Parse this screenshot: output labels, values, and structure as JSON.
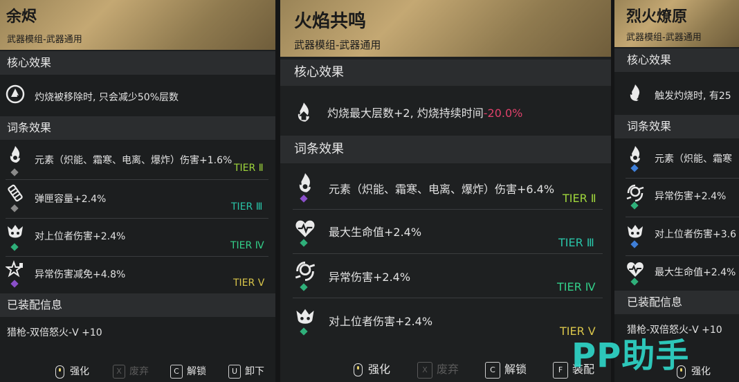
{
  "colors": {
    "tier2": "#9fd63c",
    "tier3": "#29c4a8",
    "tier4": "#33d08a",
    "tier5": "#d9c54a",
    "negative": "#e0416b",
    "gold": "#c4a873"
  },
  "cards": [
    {
      "title": "余烬",
      "subtitle": "武器模组-武器通用",
      "core_header": "核心效果",
      "core_text": "灼烧被移除时, 只会减少50%层数",
      "affix_header": "词条效果",
      "affixes": [
        {
          "text": "元素（炽能、霜寒、电离、爆炸）伤害+1.6%",
          "tier": "TIER Ⅱ",
          "icon": "flame-element-icon",
          "gem": "gray"
        },
        {
          "text": "弹匣容量+2.4%",
          "tier": "TIER Ⅲ",
          "icon": "magazine-icon",
          "gem": "gray"
        },
        {
          "text": "对上位者伤害+2.4%",
          "tier": "TIER Ⅳ",
          "icon": "demon-skull-icon",
          "gem": "green"
        },
        {
          "text": "异常伤害减免+4.8%",
          "tier": "TIER Ⅴ",
          "icon": "star-shield-icon",
          "gem": "purple"
        }
      ],
      "equip_header": "已装配信息",
      "equip_text": "猎枪-双倍怒火-Ⅴ +10",
      "actions": [
        {
          "key": "mouse",
          "label": "强化",
          "disabled": false
        },
        {
          "key": "X",
          "label": "废弃",
          "disabled": true
        },
        {
          "key": "C",
          "label": "解锁",
          "disabled": false
        },
        {
          "key": "U",
          "label": "卸下",
          "disabled": false
        }
      ]
    },
    {
      "title": "火焰共鸣",
      "subtitle": "武器模组-武器通用",
      "core_header": "核心效果",
      "core_text": "灼烧最大层数+2, 灼烧持续时间",
      "core_neg": "-20.0%",
      "affix_header": "词条效果",
      "affixes": [
        {
          "text": "元素（炽能、霜寒、电离、爆炸）伤害+6.4%",
          "tier": "TIER Ⅱ",
          "icon": "flame-element-icon",
          "gem": "purple"
        },
        {
          "text": "最大生命值+2.4%",
          "tier": "TIER Ⅲ",
          "icon": "heart-pulse-icon",
          "gem": "green"
        },
        {
          "text": "异常伤害+2.4%",
          "tier": "TIER Ⅳ",
          "icon": "anomaly-icon",
          "gem": "green"
        },
        {
          "text": "对上位者伤害+2.4%",
          "tier": "TIER Ⅴ",
          "icon": "demon-skull-icon",
          "gem": "green"
        }
      ],
      "actions": [
        {
          "key": "mouse",
          "label": "强化",
          "disabled": false
        },
        {
          "key": "X",
          "label": "废弃",
          "disabled": true
        },
        {
          "key": "C",
          "label": "解锁",
          "disabled": false
        },
        {
          "key": "F",
          "label": "装配",
          "disabled": false
        }
      ]
    },
    {
      "title": "烈火燎原",
      "subtitle": "武器模组-武器通用",
      "core_header": "核心效果",
      "core_text": "触发灼烧时, 有25",
      "affix_header": "词条效果",
      "affixes": [
        {
          "text": "元素（炽能、霜寒",
          "icon": "flame-element-icon",
          "gem": "blue"
        },
        {
          "text": "异常伤害+2.4%",
          "icon": "anomaly-icon",
          "gem": "green"
        },
        {
          "text": "对上位者伤害+3.6",
          "icon": "demon-skull-icon",
          "gem": "blue"
        },
        {
          "text": "最大生命值+2.4%",
          "icon": "heart-pulse-icon",
          "gem": "green"
        }
      ],
      "equip_header": "已装配信息",
      "equip_text": "猎枪-双倍怒火-Ⅴ +10",
      "actions": [
        {
          "key": "mouse",
          "label": "强化",
          "disabled": false
        }
      ]
    }
  ],
  "watermark": "PP助手"
}
